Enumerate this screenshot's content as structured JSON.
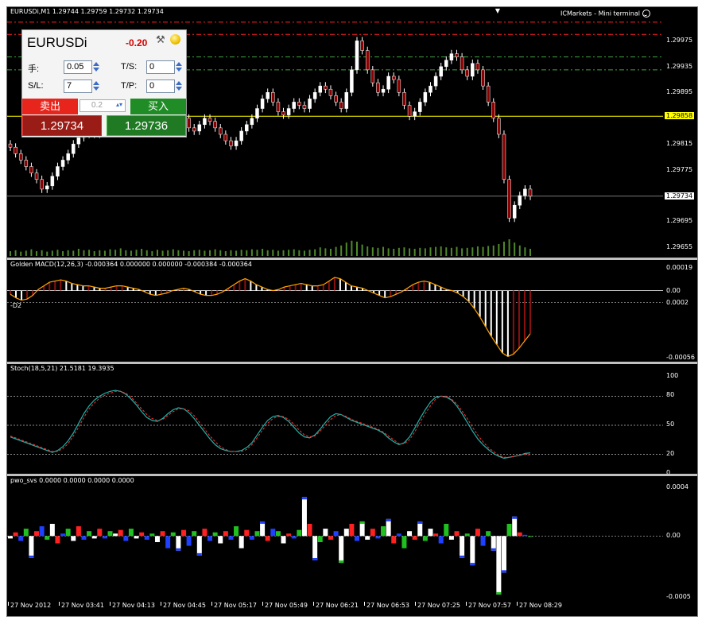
{
  "window": {
    "chart_title": "EURUSDi,M1  1.29744 1.29759 1.29732 1.29734",
    "terminal_label": "ICMarkets - Mini terminal"
  },
  "trade_panel": {
    "symbol": "EURUSDi",
    "pnl": "-0.20",
    "lots_label": "手:",
    "lots_value": "0.05",
    "sl_label": "S/L:",
    "sl_value": "7",
    "ts_label": "T/S:",
    "ts_value": "0",
    "tp_label": "T/P:",
    "tp_value": "0",
    "sell_label": "卖出",
    "buy_label": "买入",
    "lot_step": "0.2",
    "sell_price": "1.29734",
    "buy_price": "1.29736"
  },
  "colors": {
    "bull": "#ffffff",
    "bear": "#8b0000",
    "volume": "#4f8a2a",
    "bid_line": "#ffff00",
    "level_red": "#ff2020",
    "level_green": "#3fa53f",
    "macd_up": "#8b1010",
    "macd_line": "#ffa500",
    "stoch_main": "#20b2aa",
    "stoch_signal": "#ff3030"
  },
  "price_axis": {
    "labels": [
      "1.29975",
      "1.29935",
      "1.29895",
      "1.29858",
      "1.29815",
      "1.29775",
      "1.29734",
      "1.29695",
      "1.29655"
    ]
  },
  "macd_pane": {
    "title": "Golden MACD(12,26,3) -0.000364 0.000000 0.000000 -0.000384 -0.000364",
    "level_label": "-D2",
    "axis_labels": [
      "0.00019",
      "0.00",
      "0.0002",
      "-0.00056"
    ]
  },
  "stoch_pane": {
    "title": "Stoch(18,5,21) 21.5181 19.3935",
    "axis_labels": [
      "100",
      "80",
      "50",
      "20",
      "0"
    ]
  },
  "pwo_pane": {
    "title": "pwo_svs 0.0000 0.0000 0.0000 0.0000",
    "axis_labels": [
      "0.0004",
      "0.00",
      "-0.0005"
    ]
  },
  "time_axis": {
    "labels": [
      "27 Nov 2012",
      "27 Nov 03:41",
      "27 Nov 04:13",
      "27 Nov 04:45",
      "27 Nov 05:17",
      "27 Nov 05:49",
      "27 Nov 06:21",
      "27 Nov 06:53",
      "27 Nov 07:25",
      "27 Nov 07:57",
      "27 Nov 08:29"
    ]
  },
  "chart_data": [
    {
      "type": "candlestick",
      "pane": "price",
      "ylim": [
        1.29645,
        1.3001
      ],
      "bid": 1.29858,
      "last": 1.29734,
      "levels_red": [
        1.30004,
        1.29985
      ],
      "levels_green": [
        1.2995,
        1.2993
      ],
      "close": [
        1.2981,
        1.298,
        1.2979,
        1.2978,
        1.2977,
        1.2976,
        1.29745,
        1.2975,
        1.29765,
        1.2978,
        1.2979,
        1.298,
        1.29815,
        1.29825,
        1.2983,
        1.2984,
        1.2983,
        1.2985,
        1.2986,
        1.2987,
        1.2988,
        1.2989,
        1.2988,
        1.2987,
        1.2986,
        1.2985,
        1.2984,
        1.29835,
        1.29845,
        1.29855,
        1.29865,
        1.2987,
        1.29865,
        1.29855,
        1.2984,
        1.29835,
        1.29845,
        1.29855,
        1.2985,
        1.2984,
        1.2983,
        1.2982,
        1.29812,
        1.2982,
        1.29835,
        1.29845,
        1.29855,
        1.2987,
        1.29885,
        1.29895,
        1.2988,
        1.29865,
        1.2986,
        1.2987,
        1.2988,
        1.29875,
        1.2987,
        1.29885,
        1.29895,
        1.29905,
        1.299,
        1.2989,
        1.2988,
        1.2987,
        1.29895,
        1.2993,
        1.29975,
        1.2996,
        1.2993,
        1.2991,
        1.29895,
        1.299,
        1.2992,
        1.29915,
        1.29895,
        1.29875,
        1.29858,
        1.29865,
        1.2988,
        1.29895,
        1.29905,
        1.2992,
        1.29935,
        1.29945,
        1.29955,
        1.2995,
        1.2993,
        1.2992,
        1.2994,
        1.2993,
        1.29905,
        1.2988,
        1.29855,
        1.2983,
        1.2976,
        1.297,
        1.2972,
        1.29735,
        1.29745,
        1.29734
      ],
      "volume": [
        0.1,
        0.12,
        0.09,
        0.11,
        0.14,
        0.1,
        0.12,
        0.09,
        0.11,
        0.13,
        0.1,
        0.12,
        0.11,
        0.15,
        0.12,
        0.13,
        0.1,
        0.12,
        0.11,
        0.14,
        0.13,
        0.16,
        0.12,
        0.11,
        0.13,
        0.15,
        0.12,
        0.1,
        0.13,
        0.11,
        0.12,
        0.14,
        0.12,
        0.11,
        0.1,
        0.12,
        0.13,
        0.11,
        0.12,
        0.14,
        0.12,
        0.1,
        0.12,
        0.11,
        0.13,
        0.12,
        0.14,
        0.13,
        0.15,
        0.12,
        0.13,
        0.11,
        0.12,
        0.13,
        0.14,
        0.12,
        0.11,
        0.13,
        0.14,
        0.18,
        0.16,
        0.15,
        0.19,
        0.22,
        0.28,
        0.32,
        0.3,
        0.24,
        0.2,
        0.18,
        0.17,
        0.19,
        0.16,
        0.15,
        0.17,
        0.18,
        0.16,
        0.15,
        0.17,
        0.16,
        0.18,
        0.19,
        0.2,
        0.18,
        0.17,
        0.19,
        0.16,
        0.17,
        0.18,
        0.2,
        0.19,
        0.21,
        0.22,
        0.25,
        0.3,
        0.35,
        0.28,
        0.22,
        0.18,
        0.15
      ]
    },
    {
      "type": "histogram",
      "pane": "golden_macd",
      "ylim": [
        -0.00058,
        0.00019
      ],
      "values": [
        -3e-05,
        -6e-05,
        -8e-05,
        -7e-05,
        -4e-05,
        1e-05,
        4e-05,
        7e-05,
        8e-05,
        9e-05,
        8e-05,
        6e-05,
        5e-05,
        4e-05,
        4e-05,
        3e-05,
        2e-05,
        2e-05,
        3e-05,
        4e-05,
        4e-05,
        3e-05,
        2e-05,
        1e-05,
        -1e-05,
        -3e-05,
        -4e-05,
        -3e-05,
        -2e-05,
        0.0,
        1e-05,
        2e-05,
        1e-05,
        -1e-05,
        -3e-05,
        -4e-05,
        -4e-05,
        -3e-05,
        -1e-05,
        2e-05,
        5e-05,
        8e-05,
        0.0001,
        8e-05,
        5e-05,
        3e-05,
        1e-05,
        0.0,
        1e-05,
        3e-05,
        4e-05,
        5e-05,
        6e-05,
        5e-05,
        4e-05,
        4e-05,
        5e-05,
        8e-05,
        0.00011,
        0.0001,
        7e-05,
        4e-05,
        3e-05,
        2e-05,
        0.0,
        -2e-05,
        -4e-05,
        -6e-05,
        -5e-05,
        -3e-05,
        -1e-05,
        2e-05,
        5e-05,
        7e-05,
        8e-05,
        7e-05,
        5e-05,
        3e-05,
        1e-05,
        0.0,
        -2e-05,
        -5e-05,
        -9e-05,
        -0.00015,
        -0.00022,
        -0.0003,
        -0.00038,
        -0.00045,
        -0.00052,
        -0.00055,
        -0.00053,
        -0.00048,
        -0.00042,
        -0.00036
      ]
    },
    {
      "type": "line",
      "pane": "stochastic",
      "ylim": [
        0,
        100
      ],
      "levels": [
        80,
        50,
        20
      ],
      "main": [
        38,
        36,
        34,
        32,
        30,
        28,
        26,
        24,
        22,
        24,
        28,
        34,
        42,
        52,
        62,
        70,
        76,
        80,
        83,
        85,
        86,
        85,
        82,
        77,
        71,
        64,
        58,
        55,
        54,
        57,
        62,
        66,
        68,
        67,
        63,
        57,
        50,
        43,
        36,
        30,
        26,
        24,
        23,
        23,
        24,
        27,
        32,
        40,
        48,
        55,
        59,
        60,
        58,
        54,
        48,
        42,
        38,
        37,
        40,
        46,
        53,
        59,
        62,
        61,
        58,
        55,
        53,
        51,
        49,
        47,
        45,
        42,
        37,
        33,
        30,
        32,
        38,
        47,
        57,
        66,
        74,
        79,
        80,
        79,
        76,
        70,
        62,
        53,
        44,
        36,
        30,
        25,
        21,
        18,
        16,
        17,
        18,
        19,
        21,
        21.5
      ],
      "signal": [
        39,
        37,
        35,
        33,
        31,
        29,
        27,
        25,
        23,
        23,
        26,
        31,
        39,
        48,
        58,
        67,
        73,
        78,
        81,
        83,
        85,
        85,
        83,
        79,
        73,
        67,
        61,
        57,
        55,
        56,
        60,
        64,
        67,
        67,
        65,
        60,
        53,
        46,
        39,
        33,
        28,
        25,
        23,
        23,
        23,
        25,
        30,
        37,
        45,
        52,
        57,
        59,
        59,
        56,
        51,
        45,
        40,
        38,
        39,
        44,
        50,
        56,
        60,
        61,
        59,
        56,
        54,
        52,
        50,
        48,
        46,
        43,
        39,
        35,
        31,
        31,
        35,
        43,
        53,
        62,
        70,
        77,
        80,
        80,
        77,
        72,
        65,
        57,
        48,
        40,
        33,
        27,
        23,
        19,
        17,
        17,
        18,
        19,
        20,
        19.4
      ]
    },
    {
      "type": "histogram",
      "pane": "pwo_svs",
      "ylim": [
        -0.0005,
        0.0004
      ],
      "values": [
        -2e-05,
        3e-05,
        -4e-05,
        6e-05,
        -0.00018,
        4e-05,
        8e-05,
        -3e-05,
        0.0001,
        -6e-05,
        2e-05,
        6e-05,
        -4e-05,
        8e-05,
        -3e-05,
        4e-05,
        -2e-05,
        6e-05,
        -2e-05,
        4e-05,
        2e-05,
        5e-05,
        -4e-05,
        6e-05,
        -2e-05,
        3e-05,
        -3e-05,
        2e-05,
        -5e-05,
        4e-05,
        -0.0001,
        3e-05,
        -0.00012,
        5e-05,
        -8e-05,
        4e-05,
        -0.00016,
        6e-05,
        -4e-05,
        3e-05,
        -6e-05,
        4e-05,
        -3e-05,
        8e-05,
        -0.0001,
        5e-05,
        -3e-05,
        4e-05,
        0.00012,
        -4e-05,
        6e-05,
        4e-05,
        -6e-05,
        2e-05,
        -2e-05,
        5e-05,
        0.00032,
        0.0001,
        -0.0002,
        -5e-05,
        6e-05,
        -3e-05,
        4e-05,
        -0.00022,
        6e-05,
        0.0001,
        -4e-05,
        0.00012,
        -3e-05,
        6e-05,
        -2e-05,
        8e-05,
        0.00014,
        -6e-05,
        2e-05,
        -0.0001,
        4e-05,
        -3e-05,
        0.00012,
        -4e-05,
        6e-05,
        2e-05,
        -6e-05,
        0.0001,
        -3e-05,
        4e-05,
        -0.00018,
        2e-05,
        -0.00024,
        6e-05,
        -8e-05,
        4e-05,
        -0.00012,
        -0.00048,
        -0.0003,
        0.0001,
        0.00016,
        3e-05,
        1e-05,
        0.0
      ]
    }
  ]
}
